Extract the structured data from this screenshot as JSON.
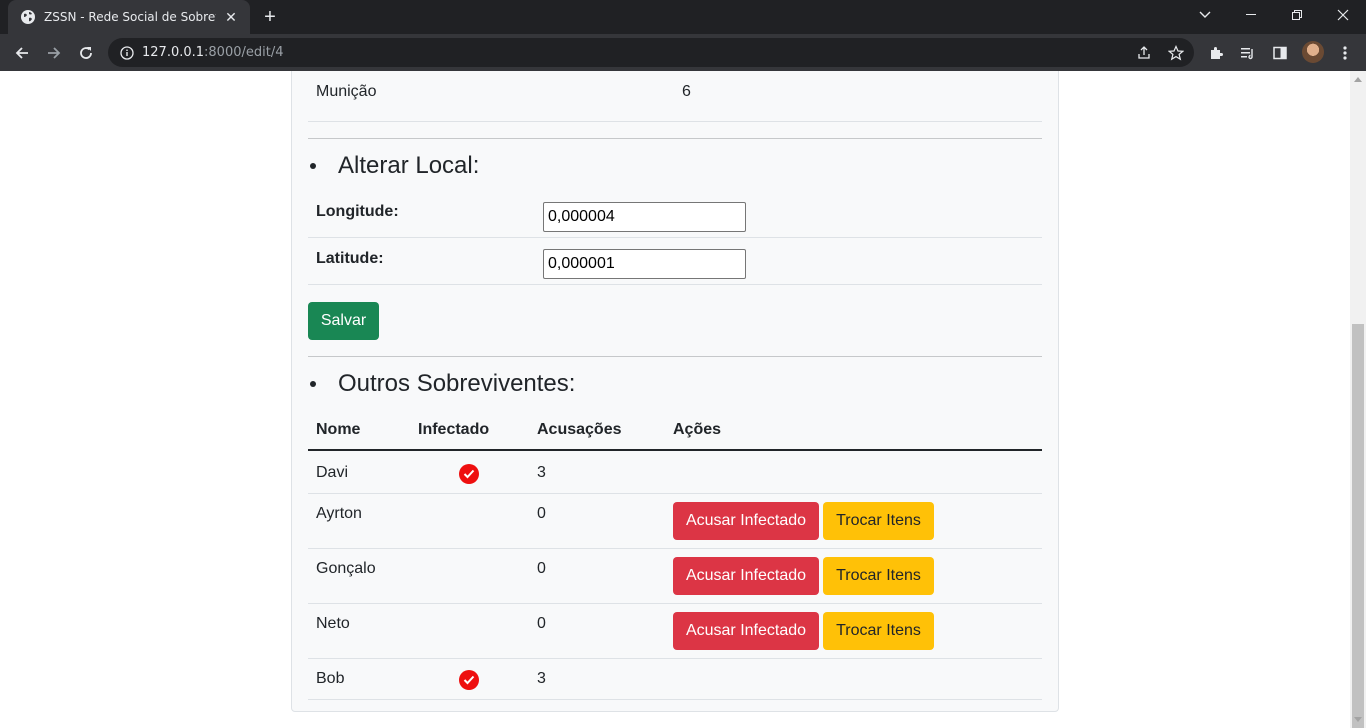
{
  "browser": {
    "tab_title": "ZSSN - Rede Social de Sobreviventes",
    "url_host": "127.0.0.1",
    "url_rest": ":8000/edit/4"
  },
  "page": {
    "municao_label": "Munição",
    "municao_value": "6",
    "alterar_local_heading": "Alterar Local:",
    "longitude_label": "Longitude:",
    "longitude_value": "0,000004",
    "latitude_label": "Latitude:",
    "latitude_value": "0,000001",
    "save_label": "Salvar",
    "outros_heading": "Outros Sobreviventes:",
    "table": {
      "headers": [
        "Nome",
        "Infectado",
        "Acusações",
        "Ações"
      ],
      "rows": [
        {
          "nome": "Davi",
          "infectado": true,
          "acusacoes": "3"
        },
        {
          "nome": "Ayrton",
          "infectado": false,
          "acusacoes": "0"
        },
        {
          "nome": "Gonçalo",
          "infectado": false,
          "acusacoes": "0"
        },
        {
          "nome": "Neto",
          "infectado": false,
          "acusacoes": "0"
        },
        {
          "nome": "Bob",
          "infectado": true,
          "acusacoes": "3"
        }
      ],
      "accuse_label": "Acusar Infectado",
      "trade_label": "Trocar Itens"
    }
  },
  "colors": {
    "success": "#198754",
    "danger": "#dc3545",
    "warning": "#ffc107",
    "infected_check": "#ee0f0f"
  }
}
